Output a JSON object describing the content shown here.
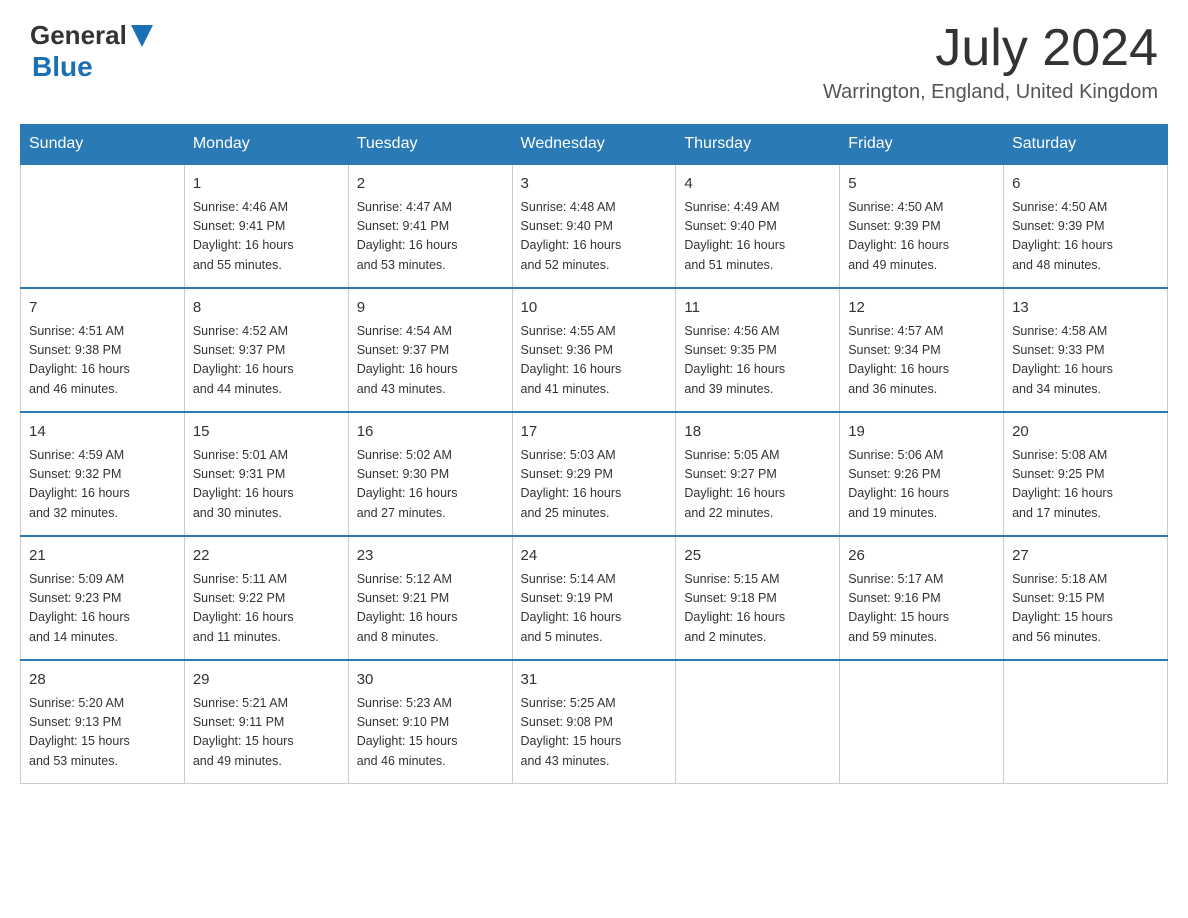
{
  "header": {
    "logo_general": "General",
    "logo_blue": "Blue",
    "month_title": "July 2024",
    "location": "Warrington, England, United Kingdom"
  },
  "calendar": {
    "days_of_week": [
      "Sunday",
      "Monday",
      "Tuesday",
      "Wednesday",
      "Thursday",
      "Friday",
      "Saturday"
    ],
    "weeks": [
      [
        {
          "day": "",
          "info": ""
        },
        {
          "day": "1",
          "info": "Sunrise: 4:46 AM\nSunset: 9:41 PM\nDaylight: 16 hours\nand 55 minutes."
        },
        {
          "day": "2",
          "info": "Sunrise: 4:47 AM\nSunset: 9:41 PM\nDaylight: 16 hours\nand 53 minutes."
        },
        {
          "day": "3",
          "info": "Sunrise: 4:48 AM\nSunset: 9:40 PM\nDaylight: 16 hours\nand 52 minutes."
        },
        {
          "day": "4",
          "info": "Sunrise: 4:49 AM\nSunset: 9:40 PM\nDaylight: 16 hours\nand 51 minutes."
        },
        {
          "day": "5",
          "info": "Sunrise: 4:50 AM\nSunset: 9:39 PM\nDaylight: 16 hours\nand 49 minutes."
        },
        {
          "day": "6",
          "info": "Sunrise: 4:50 AM\nSunset: 9:39 PM\nDaylight: 16 hours\nand 48 minutes."
        }
      ],
      [
        {
          "day": "7",
          "info": "Sunrise: 4:51 AM\nSunset: 9:38 PM\nDaylight: 16 hours\nand 46 minutes."
        },
        {
          "day": "8",
          "info": "Sunrise: 4:52 AM\nSunset: 9:37 PM\nDaylight: 16 hours\nand 44 minutes."
        },
        {
          "day": "9",
          "info": "Sunrise: 4:54 AM\nSunset: 9:37 PM\nDaylight: 16 hours\nand 43 minutes."
        },
        {
          "day": "10",
          "info": "Sunrise: 4:55 AM\nSunset: 9:36 PM\nDaylight: 16 hours\nand 41 minutes."
        },
        {
          "day": "11",
          "info": "Sunrise: 4:56 AM\nSunset: 9:35 PM\nDaylight: 16 hours\nand 39 minutes."
        },
        {
          "day": "12",
          "info": "Sunrise: 4:57 AM\nSunset: 9:34 PM\nDaylight: 16 hours\nand 36 minutes."
        },
        {
          "day": "13",
          "info": "Sunrise: 4:58 AM\nSunset: 9:33 PM\nDaylight: 16 hours\nand 34 minutes."
        }
      ],
      [
        {
          "day": "14",
          "info": "Sunrise: 4:59 AM\nSunset: 9:32 PM\nDaylight: 16 hours\nand 32 minutes."
        },
        {
          "day": "15",
          "info": "Sunrise: 5:01 AM\nSunset: 9:31 PM\nDaylight: 16 hours\nand 30 minutes."
        },
        {
          "day": "16",
          "info": "Sunrise: 5:02 AM\nSunset: 9:30 PM\nDaylight: 16 hours\nand 27 minutes."
        },
        {
          "day": "17",
          "info": "Sunrise: 5:03 AM\nSunset: 9:29 PM\nDaylight: 16 hours\nand 25 minutes."
        },
        {
          "day": "18",
          "info": "Sunrise: 5:05 AM\nSunset: 9:27 PM\nDaylight: 16 hours\nand 22 minutes."
        },
        {
          "day": "19",
          "info": "Sunrise: 5:06 AM\nSunset: 9:26 PM\nDaylight: 16 hours\nand 19 minutes."
        },
        {
          "day": "20",
          "info": "Sunrise: 5:08 AM\nSunset: 9:25 PM\nDaylight: 16 hours\nand 17 minutes."
        }
      ],
      [
        {
          "day": "21",
          "info": "Sunrise: 5:09 AM\nSunset: 9:23 PM\nDaylight: 16 hours\nand 14 minutes."
        },
        {
          "day": "22",
          "info": "Sunrise: 5:11 AM\nSunset: 9:22 PM\nDaylight: 16 hours\nand 11 minutes."
        },
        {
          "day": "23",
          "info": "Sunrise: 5:12 AM\nSunset: 9:21 PM\nDaylight: 16 hours\nand 8 minutes."
        },
        {
          "day": "24",
          "info": "Sunrise: 5:14 AM\nSunset: 9:19 PM\nDaylight: 16 hours\nand 5 minutes."
        },
        {
          "day": "25",
          "info": "Sunrise: 5:15 AM\nSunset: 9:18 PM\nDaylight: 16 hours\nand 2 minutes."
        },
        {
          "day": "26",
          "info": "Sunrise: 5:17 AM\nSunset: 9:16 PM\nDaylight: 15 hours\nand 59 minutes."
        },
        {
          "day": "27",
          "info": "Sunrise: 5:18 AM\nSunset: 9:15 PM\nDaylight: 15 hours\nand 56 minutes."
        }
      ],
      [
        {
          "day": "28",
          "info": "Sunrise: 5:20 AM\nSunset: 9:13 PM\nDaylight: 15 hours\nand 53 minutes."
        },
        {
          "day": "29",
          "info": "Sunrise: 5:21 AM\nSunset: 9:11 PM\nDaylight: 15 hours\nand 49 minutes."
        },
        {
          "day": "30",
          "info": "Sunrise: 5:23 AM\nSunset: 9:10 PM\nDaylight: 15 hours\nand 46 minutes."
        },
        {
          "day": "31",
          "info": "Sunrise: 5:25 AM\nSunset: 9:08 PM\nDaylight: 15 hours\nand 43 minutes."
        },
        {
          "day": "",
          "info": ""
        },
        {
          "day": "",
          "info": ""
        },
        {
          "day": "",
          "info": ""
        }
      ]
    ]
  }
}
